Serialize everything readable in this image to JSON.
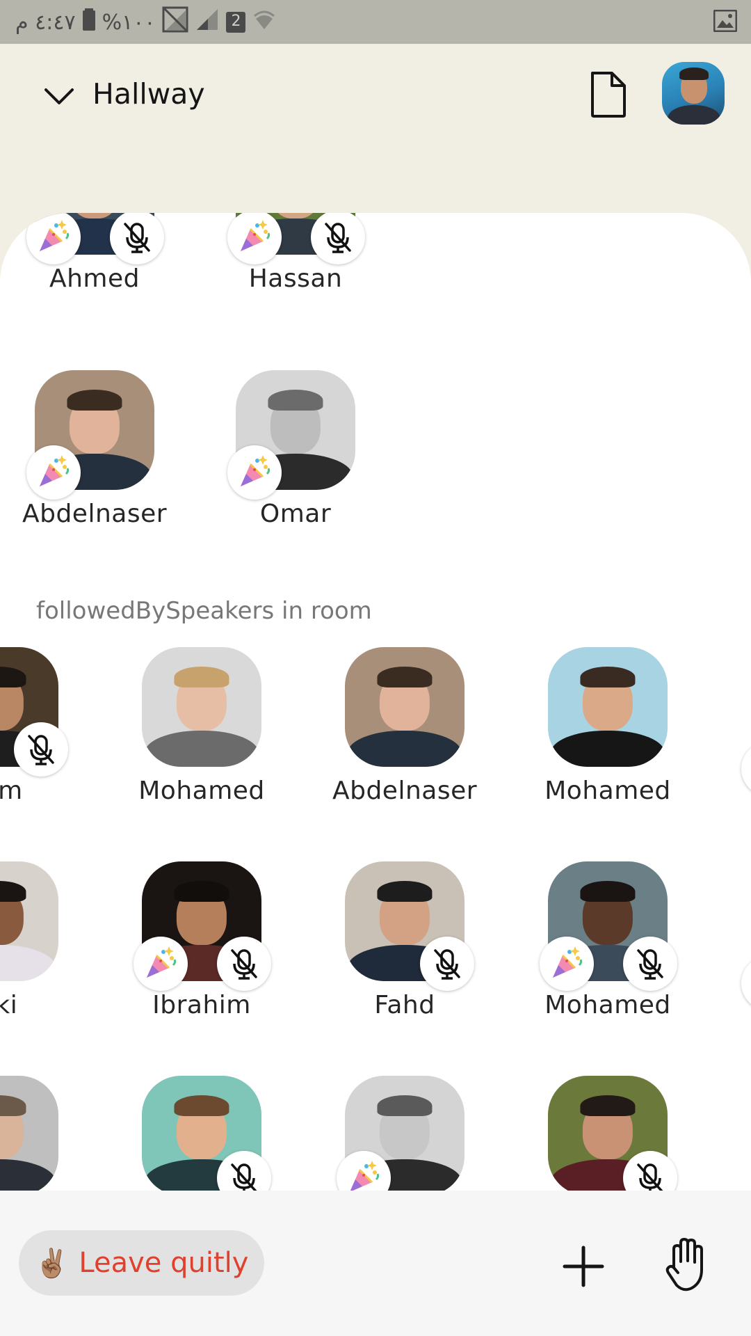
{
  "status_bar": {
    "time": "٤:٤٧ م",
    "battery": "%١٠٠",
    "sim_slot": "2"
  },
  "header": {
    "room_title": "Hallway"
  },
  "speakers": [
    {
      "name": "Ahmed",
      "badges": [
        "party-icon",
        "mic-off-icon"
      ]
    },
    {
      "name": "Hassan",
      "badges": [
        "party-icon",
        "mic-off-icon"
      ]
    },
    {
      "name": "Abdelnaser",
      "badges": [
        "party-icon"
      ]
    },
    {
      "name": "Omar",
      "badges": [
        "party-icon"
      ]
    }
  ],
  "followed": {
    "title": "followedBySpeakers in room",
    "users": [
      {
        "name": "him",
        "badges": [
          "mic-off-icon"
        ]
      },
      {
        "name": "Mohamed",
        "badges": []
      },
      {
        "name": "Abdelnaser",
        "badges": []
      },
      {
        "name": "Mohamed",
        "badges": []
      },
      {
        "name": "aki",
        "badges": []
      },
      {
        "name": "Ibrahim",
        "badges": [
          "party-icon",
          "mic-off-icon"
        ]
      },
      {
        "name": "Fahd",
        "badges": [
          "mic-off-icon"
        ]
      },
      {
        "name": "Mohamed",
        "badges": [
          "party-icon",
          "mic-off-icon"
        ]
      },
      {
        "name": "",
        "badges": []
      },
      {
        "name": "",
        "badges": [
          "mic-off-icon"
        ]
      },
      {
        "name": "",
        "badges": [
          "party-icon"
        ]
      },
      {
        "name": "",
        "badges": [
          "mic-off-icon"
        ]
      }
    ]
  },
  "bottom_bar": {
    "leave_label": "Leave quitly",
    "leave_emoji": "✌🏽"
  },
  "colors": {
    "header_bg": "#f1efe4",
    "leave_text": "#e0412f",
    "leave_bg": "#e2e2e2"
  }
}
